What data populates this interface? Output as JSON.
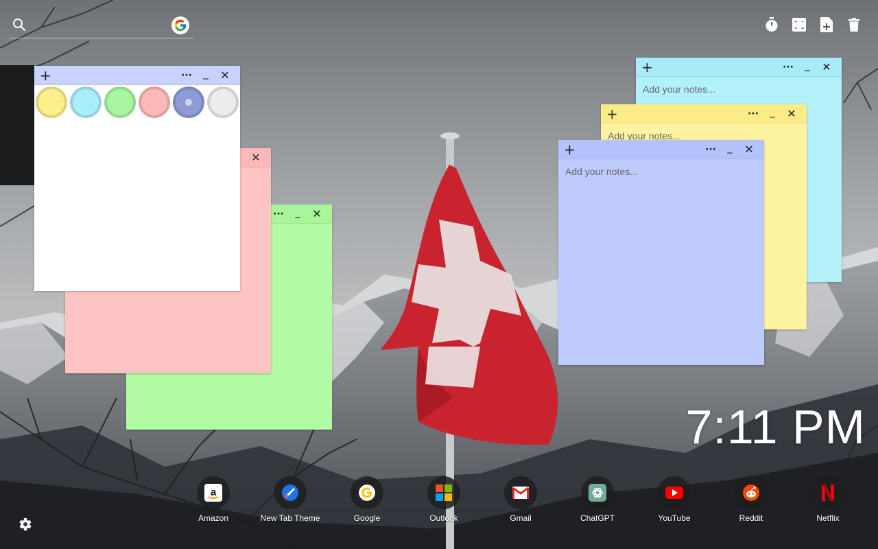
{
  "search": {
    "placeholder": ""
  },
  "toolbar": {
    "icons": [
      "timer-icon",
      "calculator-icon",
      "add-note-icon",
      "trash-icon"
    ]
  },
  "notes": {
    "placeholder": "Add your notes...",
    "controls": {
      "add": "+",
      "menu": "···",
      "minimize": "_",
      "close": "✕"
    },
    "colors": {
      "cyan": "#b2f0fa",
      "yellow": "#fdf3a0",
      "periwinkle": "#bfcbfd",
      "green": "#b1fca4",
      "pink": "#fec3c3",
      "white": "#ffffff"
    }
  },
  "color_picker": {
    "swatches": [
      {
        "name": "yellow",
        "color": "#fbf08d"
      },
      {
        "name": "cyan",
        "color": "#a9eefa"
      },
      {
        "name": "green",
        "color": "#a8f5a0"
      },
      {
        "name": "pink",
        "color": "#fbb9b9"
      },
      {
        "name": "periwinkle",
        "color": "#8e9bd6",
        "selected": true
      },
      {
        "name": "gray",
        "color": "#ececec"
      }
    ]
  },
  "clock": {
    "time": "7:11 PM"
  },
  "shortcuts": [
    {
      "label": "Amazon",
      "icon": "amazon-icon"
    },
    {
      "label": "New Tab Theme",
      "icon": "new-tab-theme-icon"
    },
    {
      "label": "Google",
      "icon": "google-icon"
    },
    {
      "label": "Outlook",
      "icon": "outlook-icon"
    },
    {
      "label": "Gmail",
      "icon": "gmail-icon"
    },
    {
      "label": "ChatGPT",
      "icon": "chatgpt-icon"
    },
    {
      "label": "YouTube",
      "icon": "youtube-icon"
    },
    {
      "label": "Reddit",
      "icon": "reddit-icon"
    },
    {
      "label": "Netflix",
      "icon": "netflix-icon"
    }
  ],
  "wallpaper": {
    "subject": "swiss-flag-mountains"
  }
}
